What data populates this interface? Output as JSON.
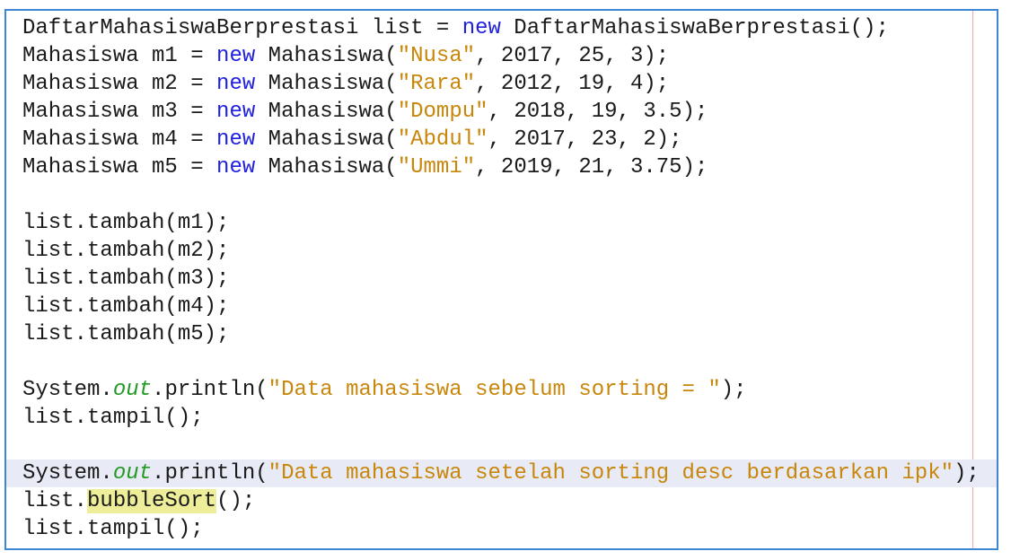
{
  "editor": {
    "colors": {
      "keyword": "#1f1fe0",
      "string": "#c8860a",
      "field": "#239a23",
      "highlight": "#eeee9a",
      "current_line": "#e8ebf6",
      "border": "#3d86d4"
    },
    "current_line": 16,
    "lines": [
      [
        {
          "t": "DaftarMahasiswaBerprestasi list = "
        },
        {
          "t": "new",
          "k": "kw"
        },
        {
          "t": " DaftarMahasiswaBerprestasi();"
        }
      ],
      [
        {
          "t": "Mahasiswa m1 = "
        },
        {
          "t": "new",
          "k": "kw"
        },
        {
          "t": " Mahasiswa("
        },
        {
          "t": "\"Nusa\"",
          "k": "str"
        },
        {
          "t": ", 2017, 25, 3);"
        }
      ],
      [
        {
          "t": "Mahasiswa m2 = "
        },
        {
          "t": "new",
          "k": "kw"
        },
        {
          "t": " Mahasiswa("
        },
        {
          "t": "\"Rara\"",
          "k": "str"
        },
        {
          "t": ", 2012, 19, 4);"
        }
      ],
      [
        {
          "t": "Mahasiswa m3 = "
        },
        {
          "t": "new",
          "k": "kw"
        },
        {
          "t": " Mahasiswa("
        },
        {
          "t": "\"Dompu\"",
          "k": "str"
        },
        {
          "t": ", 2018, 19, 3.5);"
        }
      ],
      [
        {
          "t": "Mahasiswa m4 = "
        },
        {
          "t": "new",
          "k": "kw"
        },
        {
          "t": " Mahasiswa("
        },
        {
          "t": "\"Abdul\"",
          "k": "str"
        },
        {
          "t": ", 2017, 23, 2);"
        }
      ],
      [
        {
          "t": "Mahasiswa m5 = "
        },
        {
          "t": "new",
          "k": "kw"
        },
        {
          "t": " Mahasiswa("
        },
        {
          "t": "\"Ummi\"",
          "k": "str"
        },
        {
          "t": ", 2019, 21, 3.75);"
        }
      ],
      [],
      [
        {
          "t": "list.tambah(m1);"
        }
      ],
      [
        {
          "t": "list.tambah(m2);"
        }
      ],
      [
        {
          "t": "list.tambah(m3);"
        }
      ],
      [
        {
          "t": "list.tambah(m4);"
        }
      ],
      [
        {
          "t": "list.tambah(m5);"
        }
      ],
      [],
      [
        {
          "t": "System."
        },
        {
          "t": "out",
          "k": "field"
        },
        {
          "t": ".println("
        },
        {
          "t": "\"Data mahasiswa sebelum sorting = \"",
          "k": "str"
        },
        {
          "t": ");"
        }
      ],
      [
        {
          "t": "list.tampil();"
        }
      ],
      [],
      [
        {
          "t": "System."
        },
        {
          "t": "out",
          "k": "field"
        },
        {
          "t": ".println("
        },
        {
          "t": "\"Data mahasiswa setelah sorting desc berdasarkan ipk\"",
          "k": "str"
        },
        {
          "t": ");"
        }
      ],
      [
        {
          "t": "list."
        },
        {
          "t": "bubbleSort",
          "k": "hl"
        },
        {
          "t": "();"
        }
      ],
      [
        {
          "t": "list.tampil();"
        }
      ]
    ]
  }
}
